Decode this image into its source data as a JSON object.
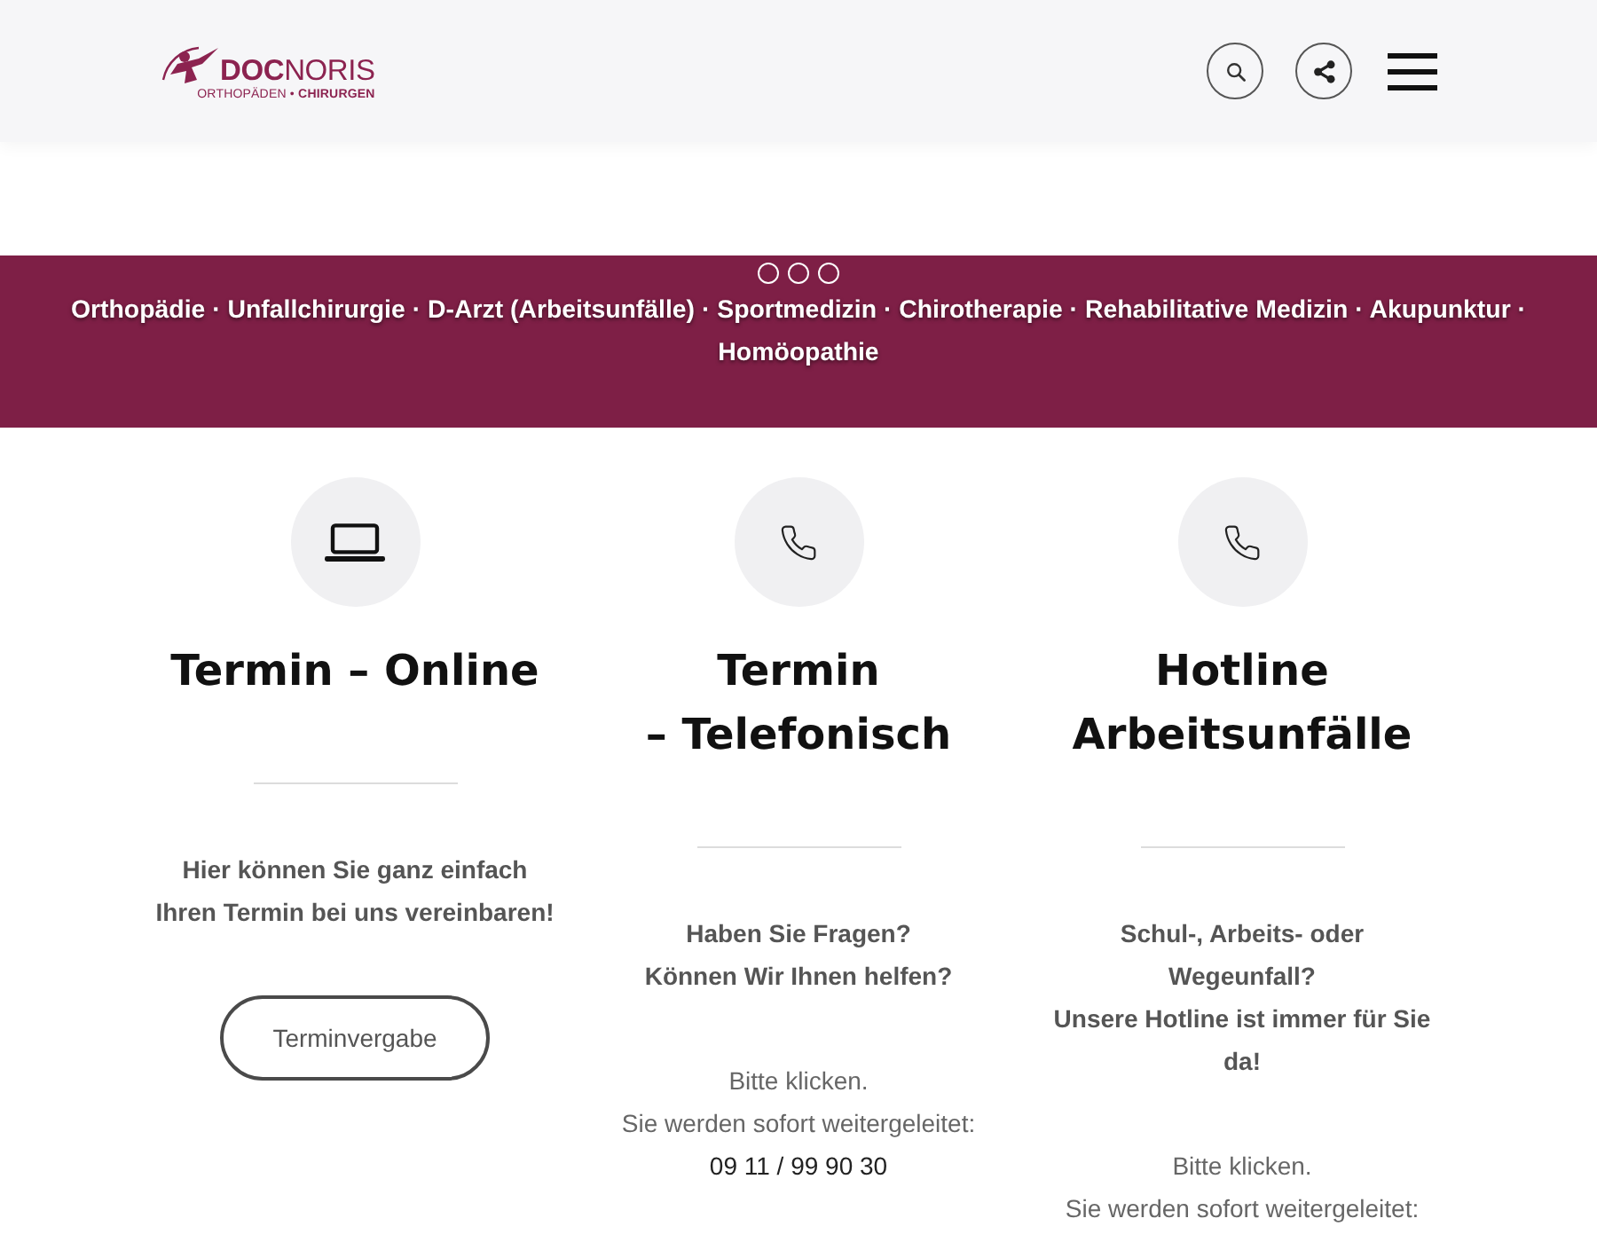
{
  "header": {
    "logo": {
      "wordmark": "**DOC**NORIS",
      "tagline": "ORTHOPÄDEN • **CHIRURGEN**"
    }
  },
  "banner": {
    "slider_dots": [
      {
        "selected": false
      },
      {
        "selected": false
      },
      {
        "selected": false
      }
    ],
    "services": "Orthopädie · Unfallchirurgie · D-Arzt (Arbeitsunfälle) · Sportmedizin · Chirotherapie · Rehabilitative Medizin · Akupunktur · Homöopathie"
  },
  "cards": [
    {
      "kind": "online",
      "title_lines": [
        "Termin – Online"
      ],
      "lead_lines": [
        "Hier können Sie ganz einfach",
        "Ihren Termin bei uns vereinbaren!"
      ],
      "button": "Terminvergabe"
    },
    {
      "kind": "phone",
      "title_lines": [
        "Termin",
        "– Telefonisch"
      ],
      "lead_lines": [
        "Haben Sie Fragen?",
        "Können Wir Ihnen helfen?"
      ],
      "note_lines": [
        "Bitte klicken.",
        "Sie werden sofort weitergeleitet:"
      ],
      "phone": "09 11 / 99 90 30"
    },
    {
      "kind": "phone",
      "title_lines": [
        "Hotline",
        "Arbeitsunfälle"
      ],
      "lead_lines": [
        "Schul-, Arbeits- oder",
        "Wegeunfall?",
        "Unsere Hotline ist immer für Sie",
        "da!"
      ],
      "note_lines": [
        "Bitte klicken.",
        "Sie werden sofort weitergeleitet:"
      ]
    }
  ]
}
